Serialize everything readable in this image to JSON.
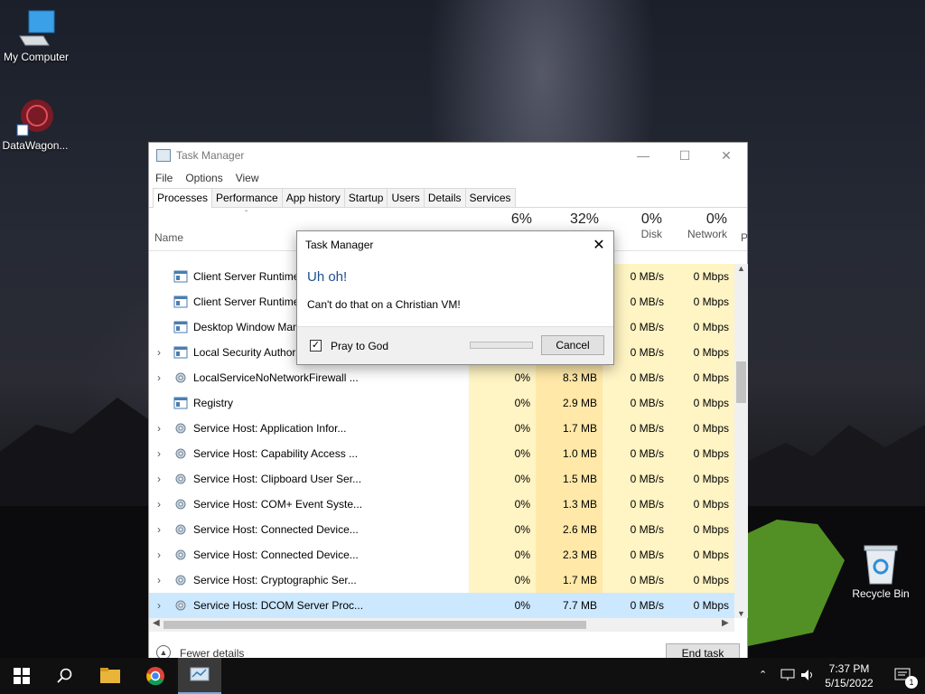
{
  "desktop": {
    "icons": [
      {
        "label": "My Computer",
        "icon": "computer-icon"
      },
      {
        "label": "DataWagon...",
        "icon": "datawagon-shortcut-icon"
      },
      {
        "label": "Recycle Bin",
        "icon": "recycle-bin-icon"
      }
    ]
  },
  "window": {
    "title": "Task Manager",
    "menu": [
      "File",
      "Options",
      "View"
    ],
    "tabs": [
      "Processes",
      "Performance",
      "App history",
      "Startup",
      "Users",
      "Details",
      "Services"
    ],
    "active_tab": "Processes",
    "columns": {
      "name": "Name",
      "cpu_pct": "6%",
      "mem_pct": "32%",
      "disk_pct": "0%",
      "disk": "Disk",
      "net_pct": "0%",
      "net": "Network",
      "power": "P"
    },
    "processes": [
      {
        "name": "Client Server Runtime Process",
        "expandable": false,
        "cpu": "",
        "mem": "",
        "disk": "0 MB/s",
        "net": "0 Mbps"
      },
      {
        "name": "Client Server Runtime Process",
        "expandable": false,
        "cpu": "",
        "mem": "",
        "disk": "0 MB/s",
        "net": "0 Mbps"
      },
      {
        "name": "Desktop Window Manager",
        "expandable": false,
        "cpu": "",
        "mem": "",
        "disk": "0 MB/s",
        "net": "0 Mbps"
      },
      {
        "name": "Local Security Authority Process",
        "expandable": true,
        "cpu": "",
        "mem": "",
        "disk": "0 MB/s",
        "net": "0 Mbps"
      },
      {
        "name": "LocalServiceNoNetworkFirewall ...",
        "expandable": true,
        "cpu": "0%",
        "mem": "8.3 MB",
        "disk": "0 MB/s",
        "net": "0 Mbps"
      },
      {
        "name": "Registry",
        "expandable": false,
        "cpu": "0%",
        "mem": "2.9 MB",
        "disk": "0 MB/s",
        "net": "0 Mbps"
      },
      {
        "name": "Service Host: Application Infor...",
        "expandable": true,
        "cpu": "0%",
        "mem": "1.7 MB",
        "disk": "0 MB/s",
        "net": "0 Mbps"
      },
      {
        "name": "Service Host: Capability Access ...",
        "expandable": true,
        "cpu": "0%",
        "mem": "1.0 MB",
        "disk": "0 MB/s",
        "net": "0 Mbps"
      },
      {
        "name": "Service Host: Clipboard User Ser...",
        "expandable": true,
        "cpu": "0%",
        "mem": "1.5 MB",
        "disk": "0 MB/s",
        "net": "0 Mbps"
      },
      {
        "name": "Service Host: COM+ Event Syste...",
        "expandable": true,
        "cpu": "0%",
        "mem": "1.3 MB",
        "disk": "0 MB/s",
        "net": "0 Mbps"
      },
      {
        "name": "Service Host: Connected Device...",
        "expandable": true,
        "cpu": "0%",
        "mem": "2.6 MB",
        "disk": "0 MB/s",
        "net": "0 Mbps"
      },
      {
        "name": "Service Host: Connected Device...",
        "expandable": true,
        "cpu": "0%",
        "mem": "2.3 MB",
        "disk": "0 MB/s",
        "net": "0 Mbps"
      },
      {
        "name": "Service Host: Cryptographic Ser...",
        "expandable": true,
        "cpu": "0%",
        "mem": "1.7 MB",
        "disk": "0 MB/s",
        "net": "0 Mbps"
      },
      {
        "name": "Service Host: DCOM Server Proc...",
        "expandable": true,
        "cpu": "0%",
        "mem": "7.7 MB",
        "disk": "0 MB/s",
        "net": "0 Mbps",
        "selected": true
      }
    ],
    "footer": {
      "fewer_details": "Fewer details",
      "end_task": "End task"
    }
  },
  "dialog": {
    "title": "Task Manager",
    "heading": "Uh oh!",
    "message": "Can't do that on a Christian VM!",
    "checkbox_label": "Pray to God",
    "checkbox_checked": true,
    "cancel_label": "Cancel"
  },
  "taskbar": {
    "time": "7:37 PM",
    "date": "5/15/2022",
    "notification_count": "1"
  }
}
